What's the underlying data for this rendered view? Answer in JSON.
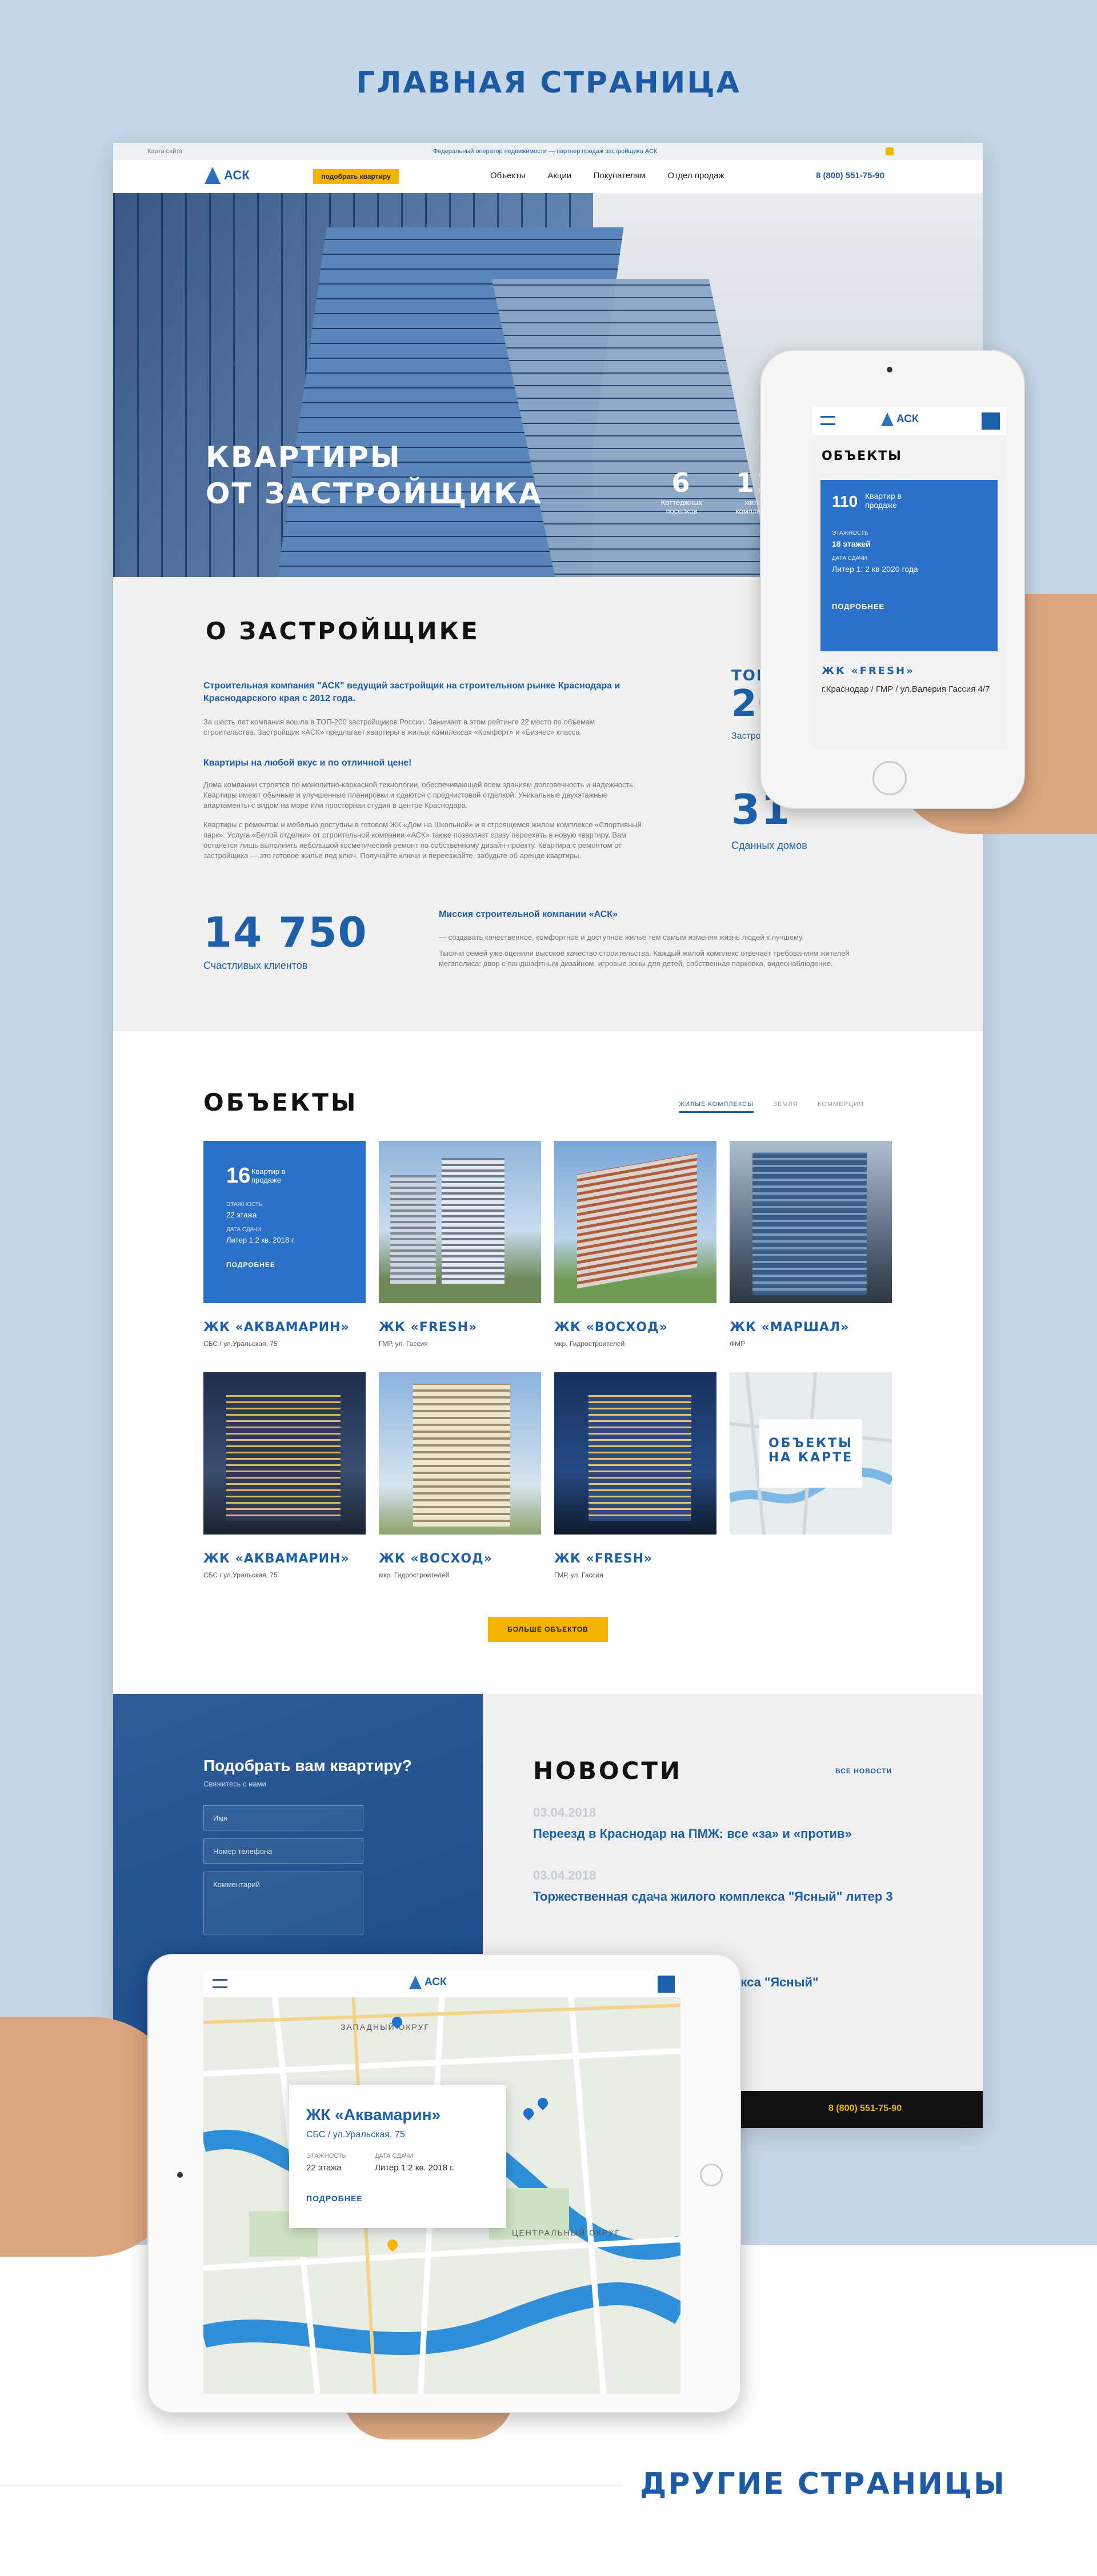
{
  "page_title": "ГЛАВНАЯ СТРАНИЦА",
  "footer_title": "ДРУГИЕ СТРАНИЦЫ",
  "colors": {
    "brand": "#1d5fa8",
    "accent": "#f5b400",
    "bg": "#c5d6e6"
  },
  "site": {
    "topbar": {
      "map": "Карта сайта",
      "partner": "Федеральный оператор недвижимости — партнер продаж застройщика АСК"
    },
    "logo": "АСК",
    "pick_button": "подобрать квартиру",
    "nav": [
      "Объекты",
      "Акции",
      "Покупателям",
      "Отдел продаж"
    ],
    "phone": "8 (800) 551-75-90",
    "hero": {
      "title_line1": "КВАРТИРЫ",
      "title_line2": "ОТ ЗАСТРОЙЩИКА",
      "stats": [
        {
          "num": "6",
          "label": "Коттеджных поселков"
        },
        {
          "num": "11",
          "label": "жилых комплексов"
        }
      ]
    },
    "about": {
      "title": "О ЗАСТРОЙЩИКЕ",
      "lead": "Строительная компания \"АСК\" ведущий застройщик на строительном рынке Краснодара и Краснодарского края с 2012 года.",
      "p1": "За шесть лет компания вошла в ТОП-200 застройщиков России. Занимает в этом рейтинге 22 место по объемам строительства. Застройщик «АСК» предлагает квартиры в жилых комплексах «Комфорт» и «Бизнес» класса.",
      "subhead": "Квартиры на любой вкус и по отличной цене!",
      "p2": "Дома компании строятся по монолитно-каркасной технологии, обеспечивающей всем зданиям долговечность и надежность. Квартиры имеют обычные и улучшенные планировки и сдаются с предчистовой отделкой. Уникальные двухэтажные апартаменты с видом на море или просторная студия в центре Краснодара.",
      "p3": "Квартиры с ремонтом и мебелью доступны в готовом ЖК «Дом на Школьной» и в строящемся жилом комплексе «Спортивный парк». Услуга «Белой отделки» от строительной компании «АСК» также позволяет сразу переехать в новую квартиру. Вам останется лишь выполнить небольшой косметический ремонт по собственному дизайн-проекту. Квартира с ремонтом от застройщика — это готовое жилье под ключ. Получайте ключи и переезжайте, забудьте об аренде квартиры.",
      "top_label": "ТОП-",
      "top_num": "200",
      "top_caption": "Застройщиков России",
      "houses_num": "31",
      "houses_label": "Сданных домов",
      "clients_num": "14 750",
      "clients_label": "Счастливых клиентов",
      "mission_title": "Миссия строительной компании «АСК»",
      "mission_p1": "— создавать качественное, комфортное и доступное жилье тем самым изменяя жизнь людей к лучшему.",
      "mission_p2": "Тысячи семей уже оценили высокое качество строительства. Каждый жилой комплекс отвечает требованиям жителей мегаполиса: двор с ландшафтным дизайном, игровые зоны для детей, собственная парковка, видеонаблюдение."
    },
    "objects": {
      "title": "ОБЪЕКТЫ",
      "tabs": [
        "ЖИЛЫЕ КОМПЛЕКСЫ",
        "ЗЕМЛЯ",
        "КОММЕРЦИЯ"
      ],
      "feature": {
        "num": "16",
        "label": "Квартир в продаже",
        "floors_label": "ЭТАЖНОСТЬ",
        "floors": "22 этажа",
        "date_label": "ДАТА СДАЧИ",
        "date": "Литер 1:2 кв. 2018 г.",
        "more": "ПОДРОБНЕЕ"
      },
      "cards": [
        {
          "title": "ЖК «АКВАМАРИН»",
          "addr": "СБС / ул.Уральская, 75"
        },
        {
          "title": "ЖК «FRESH»",
          "addr": "ГМР, ул. Гассия"
        },
        {
          "title": "ЖК «ВОСХОД»",
          "addr": "мкр. Гидростроителей"
        },
        {
          "title": "ЖК «МАРШАЛ»",
          "addr": "ФМР"
        },
        {
          "title": "ЖК «АКВАМАРИН»",
          "addr": "СБС / ул.Уральская, 75"
        },
        {
          "title": "ЖК «ВОСХОД»",
          "addr": "мкр. Гидростроителей"
        },
        {
          "title": "ЖК «FRESH»",
          "addr": "ГМР, ул. Гассия"
        }
      ],
      "map_line1": "ОБЪЕКТЫ",
      "map_line2": "НА КАРТЕ",
      "more_button": "БОЛЬШЕ ОБЪЕКТОВ"
    },
    "form": {
      "title": "Подобрать вам квартиру?",
      "sub": "Свяжитесь с нами",
      "name": "Имя",
      "phone": "Номер телефона",
      "comment": "Комментарий"
    },
    "news": {
      "title": "НОВОСТИ",
      "all": "ВСЕ НОВОСТИ",
      "items": [
        {
          "date": "03.04.2018",
          "title": "Переезд в Краснодар на ПМЖ: все «за» и «против»"
        },
        {
          "date": "03.04.2018",
          "title": "Торжественная сдача жилого комплекса \"Ясный\" литер 3"
        }
      ],
      "partial": "комплекса \"Ясный\""
    },
    "footer_phone": "8 (800) 551-75-90"
  },
  "phone_device": {
    "logo": "АСК",
    "section": "ОБЪЕКТЫ",
    "num": "110",
    "label": "Квартир в продаже",
    "floors_label": "ЭТАЖНОСТЬ",
    "floors": "18 этажей",
    "date_label": "ДАТА СДАЧИ",
    "date": "Литер 1: 2 кв 2020 года",
    "more": "ПОДРОБНЕЕ",
    "title": "ЖК «FRESH»",
    "addr": "г.Краснодар / ГМР / ул.Валерия Гассия 4/7"
  },
  "tablet_device": {
    "logo": "АСК",
    "card_title": "ЖК «Аквамарин»",
    "card_addr": "СБС / ул.Уральская, 75",
    "floors_label": "ЭТАЖНОСТЬ",
    "floors": "22 этажа",
    "date_label": "ДАТА СДАЧИ",
    "date": "Литер 1:2 кв. 2018 г.",
    "more": "ПОДРОБНЕЕ",
    "map_labels": [
      "ЗАПАДНЫЙ ОКРУГ",
      "ЦЕНТРАЛЬНЫЙ ОКРУГ"
    ]
  }
}
